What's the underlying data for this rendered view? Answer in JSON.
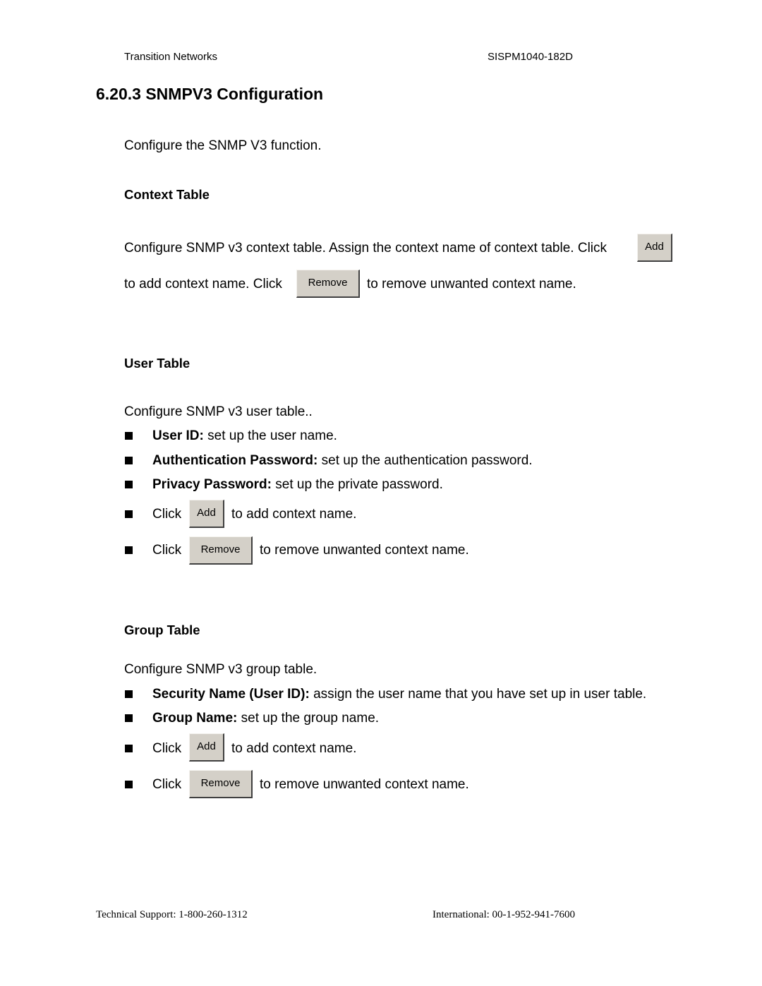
{
  "header": {
    "company": "Transition Networks",
    "doc_id": "SISPM1040-182D"
  },
  "section": {
    "title": "6.20.3 SNMPV3 Configuration",
    "intro": "Configure the SNMP V3 function."
  },
  "context_table": {
    "heading": "Context Table",
    "line1": "Configure SNMP v3 context table. Assign the context name of context table. Click",
    "line2_pre": "to add context name. Click",
    "line2_post": "to remove unwanted context name.",
    "add_label": "Add",
    "remove_label": "Remove"
  },
  "user_table": {
    "heading": "User Table",
    "intro": "Configure SNMP v3 user table..",
    "items": [
      {
        "term": "User ID:",
        "desc": " set up the user name."
      },
      {
        "term": "Authentication Password:",
        "desc": " set up the authentication password."
      },
      {
        "term": "Privacy Password:",
        "desc": " set up the private password."
      }
    ],
    "click_label": "Click",
    "add_label": "Add",
    "add_desc": "to add context name.",
    "remove_label": "Remove",
    "remove_desc": "to remove unwanted context name."
  },
  "group_table": {
    "heading": "Group Table",
    "intro": "Configure SNMP v3 group table.",
    "items": [
      {
        "term": "Security Name (User ID):",
        "desc": " assign the user name that you have set up in user table."
      },
      {
        "term": "Group Name:",
        "desc": " set up the group name."
      }
    ],
    "click_label": "Click",
    "add_label": "Add",
    "add_desc": "to add context name.",
    "remove_label": "Remove",
    "remove_desc": "to remove unwanted context name."
  },
  "footer": {
    "support": "Technical Support: 1-800-260-1312",
    "international": "International: 00-1-952-941-7600"
  }
}
